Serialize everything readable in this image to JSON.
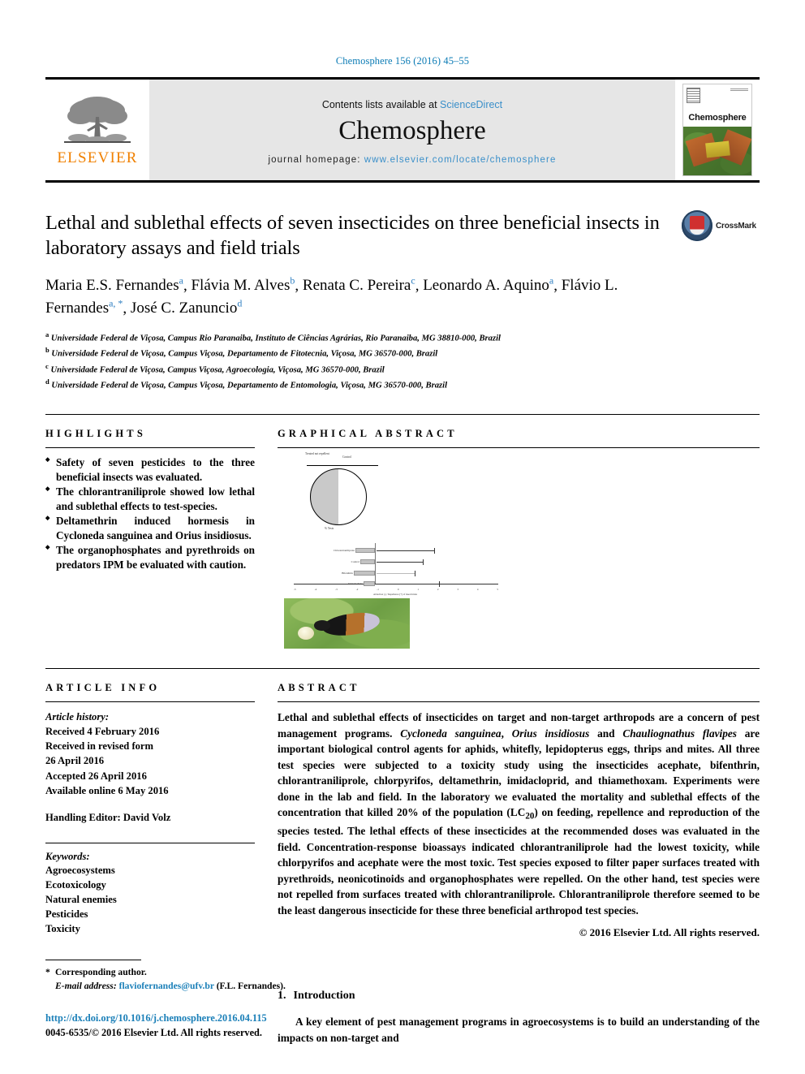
{
  "running_head": "Chemosphere 156 (2016) 45–55",
  "masthead": {
    "publisher": "ELSEVIER",
    "contents_prefix": "Contents lists available at ",
    "contents_link": "ScienceDirect",
    "journal_name": "Chemosphere",
    "homepage_prefix": "journal homepage: ",
    "homepage_url": "www.elsevier.com/locate/chemosphere",
    "cover_title": "Chemosphere"
  },
  "crossmark": {
    "label": "CrossMark"
  },
  "article": {
    "title": "Lethal and sublethal effects of seven insecticides on three beneficial insects in laboratory assays and field trials",
    "authors": [
      {
        "name": "Maria E.S. Fernandes",
        "marks": "a",
        "sep": ", "
      },
      {
        "name": "Flávia M. Alves",
        "marks": "b",
        "sep": ", "
      },
      {
        "name": "Renata C. Pereira",
        "marks": "c",
        "sep": ", "
      },
      {
        "name": "Leonardo A. Aquino",
        "marks": "a",
        "sep": ", "
      },
      {
        "name": "Flávio L. Fernandes",
        "marks": "a, *",
        "sep": ", "
      },
      {
        "name": "José C. Zanuncio",
        "marks": "d",
        "sep": ""
      }
    ],
    "affiliations": [
      {
        "mark": "a",
        "text": "Universidade Federal de Viçosa, Campus Rio Paranaiba, Instituto de Ciências Agrárias, Rio Paranaiba, MG 38810-000, Brazil"
      },
      {
        "mark": "b",
        "text": "Universidade Federal de Viçosa, Campus Viçosa, Departamento de Fitotecnia, Viçosa, MG 36570-000, Brazil"
      },
      {
        "mark": "c",
        "text": "Universidade Federal de Viçosa, Campus Viçosa, Agroecologia, Viçosa, MG 36570-000, Brazil"
      },
      {
        "mark": "d",
        "text": "Universidade Federal de Viçosa, Campus Viçosa, Departamento de Entomologia, Viçosa, MG 36570-000, Brazil"
      }
    ]
  },
  "highlights": {
    "heading": "HIGHLIGHTS",
    "items": [
      "Safety of seven pesticides to the three beneficial insects was evaluated.",
      "The chlorantraniliprole showed low lethal and sublethal effects to test-species.",
      "Deltamethrin induced hormesis in Cycloneda sanguinea and Orius insidiosus.",
      "The organophosphates and pyrethroids on predators IPM be evaluated with caution."
    ]
  },
  "graphical_abstract": {
    "heading": "GRAPHICAL ABSTRACT",
    "pie_labels": [
      "Treated not repellent",
      "Control",
      "% Tests"
    ],
    "bar_labels": [
      "Treated not repellent",
      "Treated",
      "Control",
      "Repellency"
    ],
    "bar_rows": [
      "Chlorantraniliprole",
      "Control",
      "Bifenthrin",
      "Deltamethrin"
    ],
    "x_ticks": [
      "-5",
      "-4",
      "-3",
      "-2",
      "-1",
      "0",
      "1",
      "2",
      "3",
      "4",
      "5"
    ],
    "x_label": "Attraction (-) / Repellence (+) of insecticides"
  },
  "article_info": {
    "heading": "ARTICLE INFO",
    "history_label": "Article history:",
    "history": [
      "Received 4 February 2016",
      "Received in revised form",
      "26 April 2016",
      "Accepted 26 April 2016",
      "Available online 6 May 2016"
    ],
    "handling_editor": "Handling Editor: David Volz",
    "keywords_label": "Keywords:",
    "keywords": [
      "Agroecosystems",
      "Ecotoxicology",
      "Natural enemies",
      "Pesticides",
      "Toxicity"
    ]
  },
  "abstract": {
    "heading": "ABSTRACT",
    "paragraph_1": "Lethal and sublethal effects of insecticides on target and non-target arthropods are a concern of pest management programs. ",
    "species_1": "Cycloneda sanguinea",
    "joiner_1": ", ",
    "species_2": "Orius insidiosus",
    "joiner_2": " and ",
    "species_3": "Chauliognathus flavipes",
    "paragraph_2": " are important biological control agents for aphids, whitefly, lepidopterus eggs, thrips and mites. All three test species were subjected to a toxicity study using the insecticides acephate, bifenthrin, chlorantraniliprole, chlorpyrifos, deltamethrin, imidacloprid, and thiamethoxam. Experiments were done in the lab and field. In the laboratory we evaluated the mortality and sublethal effects of the concentration that killed 20% of the population (LC",
    "subscript": "20",
    "paragraph_3": ") on feeding, repellence and reproduction of the species tested. The lethal effects of these insecticides at the recommended doses was evaluated in the field. Concentration-response bioassays indicated chlorantraniliprole had the lowest toxicity, while chlorpyrifos and acephate were the most toxic. Test species exposed to filter paper surfaces treated with pyrethroids, neonicotinoids and organophosphates were repelled. On the other hand, test species were not repelled from surfaces treated with chlorantraniliprole. Chlorantraniliprole therefore seemed to be the least dangerous insecticide for these three beneficial arthropod test species.",
    "copyright": "© 2016 Elsevier Ltd. All rights reserved."
  },
  "introduction": {
    "number": "1.",
    "heading": "Introduction",
    "paragraph": "A key element of pest management programs in agroecosystems is to build an understanding of the impacts on non-target and"
  },
  "footer": {
    "corresponding_star": "*",
    "corresponding_label": "Corresponding author.",
    "email_label": "E-mail address:",
    "email": "flaviofernandes@ufv.br",
    "email_suffix": "(F.L. Fernandes).",
    "doi": "http://dx.doi.org/10.1016/j.chemosphere.2016.04.115",
    "issn": "0045-6535/© 2016 Elsevier Ltd. All rights reserved."
  },
  "colors": {
    "link_blue": "#1a7fb8",
    "sciencedirect_blue": "#3a8fc9",
    "elsevier_orange": "#f08000",
    "masthead_gray": "#e6e6e6"
  }
}
